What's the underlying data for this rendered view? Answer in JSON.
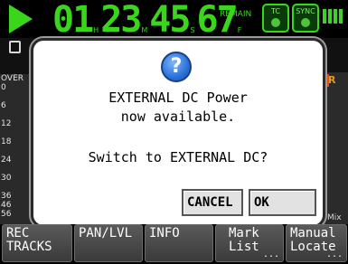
{
  "topbar": {
    "status_icon": "play-icon",
    "timecode": {
      "hours": "01",
      "minutes": "23",
      "seconds": "45",
      "frames": "67",
      "unit_h": "H",
      "unit_m": "M",
      "unit_s": "S",
      "unit_f": "F"
    },
    "remain_label": "REMAIN",
    "tc_badge": "TC",
    "sync_badge": "SYNC"
  },
  "meters": {
    "scale": [
      "OVER",
      "0",
      "6",
      "12",
      "18",
      "24",
      "30",
      "36",
      "46",
      "56"
    ],
    "right_label": "R",
    "mix_label": "Mix"
  },
  "dialog": {
    "icon": "question-icon",
    "icon_glyph": "?",
    "line1": "EXTERNAL DC Power",
    "line2": "now available.",
    "line3": "Switch to EXTERNAL DC?",
    "cancel_label": "CANCEL",
    "ok_label": "OK"
  },
  "tabs": [
    {
      "line1": "REC",
      "line2": "TRACKS",
      "more": ""
    },
    {
      "line1": "PAN/LVL",
      "line2": "",
      "more": ""
    },
    {
      "line1": "INFO",
      "line2": "",
      "more": ""
    },
    {
      "line1": "Mark",
      "line2": "List",
      "more": "..."
    },
    {
      "line1": "Manual",
      "line2": "Locate",
      "more": "..."
    }
  ],
  "colors": {
    "accent": "#39d61c",
    "dialog_bg": "#ffffff",
    "button_bg": "#e2e2e2",
    "tab_bg": "#4a4a4a",
    "question_icon": "#2c72d6"
  }
}
